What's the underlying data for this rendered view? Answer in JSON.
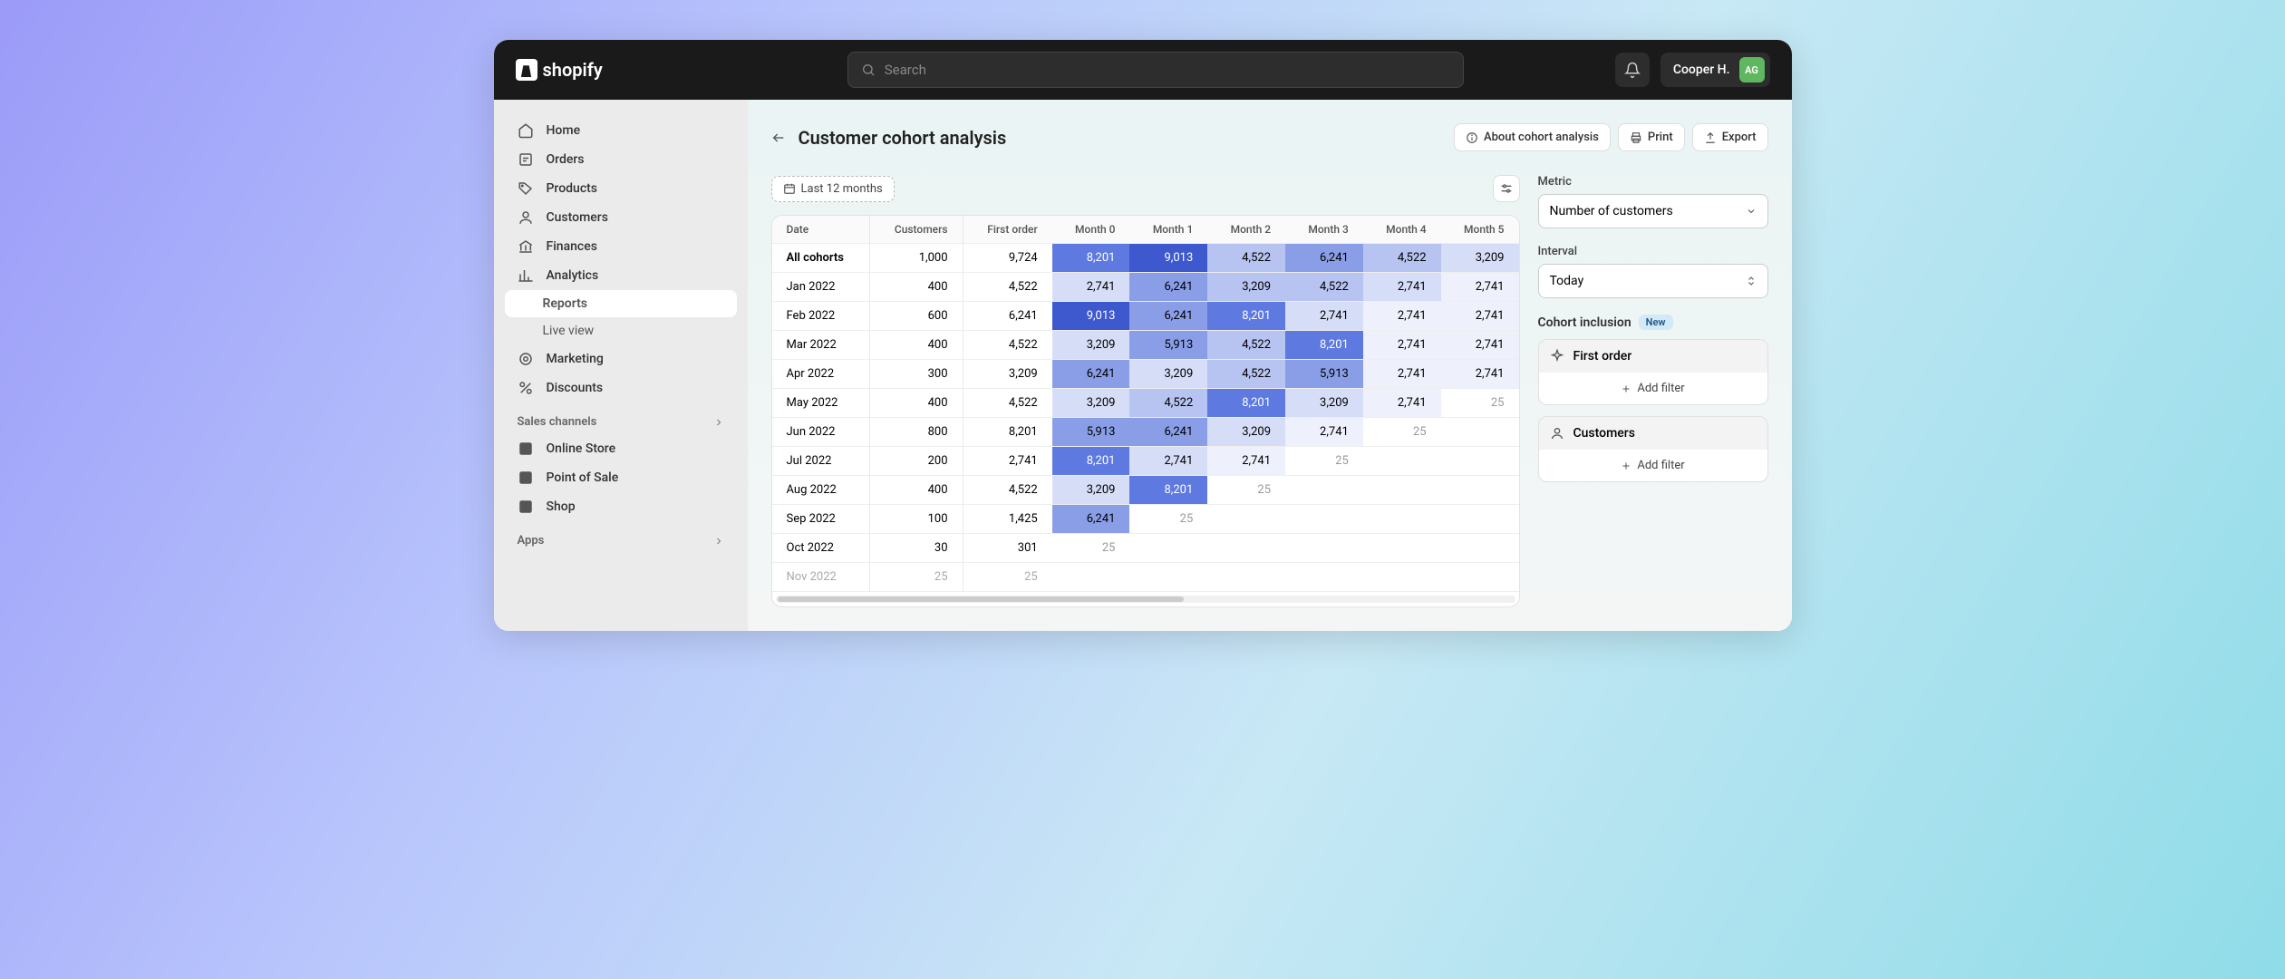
{
  "logo_text": "shopify",
  "search_placeholder": "Search",
  "user_name": "Cooper H.",
  "avatar_initials": "AG",
  "nav": {
    "home": "Home",
    "orders": "Orders",
    "products": "Products",
    "customers": "Customers",
    "finances": "Finances",
    "analytics": "Analytics",
    "reports": "Reports",
    "live_view": "Live view",
    "marketing": "Marketing",
    "discounts": "Discounts",
    "sales_channels": "Sales channels",
    "online_store": "Online Store",
    "pos": "Point of Sale",
    "shop": "Shop",
    "apps": "Apps"
  },
  "page_title": "Customer cohort analysis",
  "actions": {
    "about": "About cohort analysis",
    "print": "Print",
    "export": "Export"
  },
  "date_range": "Last 12 months",
  "right": {
    "metric_label": "Metric",
    "metric_value": "Number of customers",
    "interval_label": "Interval",
    "interval_value": "Today",
    "cohort_inclusion": "Cohort inclusion",
    "new_badge": "New",
    "first_order": "First order",
    "customers": "Customers",
    "add_filter": "Add filter"
  },
  "table": {
    "headers": [
      "Date",
      "Customers",
      "First order",
      "Month 0",
      "Month 1",
      "Month 2",
      "Month 3",
      "Month 4",
      "Month 5"
    ],
    "rows": [
      {
        "label": "All cohorts",
        "customers": "1,000",
        "first": "9,724",
        "m": [
          "8,201",
          "9,013",
          "4,522",
          "6,241",
          "4,522",
          "3,209"
        ],
        "heat": [
          5,
          6,
          3,
          4,
          3,
          2
        ]
      },
      {
        "label": "Jan 2022",
        "customers": "400",
        "first": "4,522",
        "m": [
          "2,741",
          "6,241",
          "3,209",
          "4,522",
          "2,741",
          "2,741"
        ],
        "heat": [
          2,
          4,
          3,
          3,
          2,
          1
        ]
      },
      {
        "label": "Feb 2022",
        "customers": "600",
        "first": "6,241",
        "m": [
          "9,013",
          "6,241",
          "8,201",
          "2,741",
          "2,741",
          "2,741"
        ],
        "heat": [
          6,
          4,
          5,
          2,
          1,
          1
        ]
      },
      {
        "label": "Mar 2022",
        "customers": "400",
        "first": "4,522",
        "m": [
          "3,209",
          "5,913",
          "4,522",
          "8,201",
          "2,741",
          "2,741"
        ],
        "heat": [
          2,
          4,
          3,
          5,
          1,
          1
        ]
      },
      {
        "label": "Apr 2022",
        "customers": "300",
        "first": "3,209",
        "m": [
          "6,241",
          "3,209",
          "4,522",
          "5,913",
          "2,741",
          "2,741"
        ],
        "heat": [
          4,
          2,
          3,
          4,
          1,
          1
        ]
      },
      {
        "label": "May 2022",
        "customers": "400",
        "first": "4,522",
        "m": [
          "3,209",
          "4,522",
          "8,201",
          "3,209",
          "2,741",
          "25"
        ],
        "heat": [
          2,
          3,
          5,
          2,
          1,
          0
        ]
      },
      {
        "label": "Jun 2022",
        "customers": "800",
        "first": "8,201",
        "m": [
          "5,913",
          "6,241",
          "3,209",
          "2,741",
          "25",
          ""
        ],
        "heat": [
          4,
          4,
          2,
          1,
          0,
          0
        ]
      },
      {
        "label": "Jul 2022",
        "customers": "200",
        "first": "2,741",
        "m": [
          "8,201",
          "2,741",
          "2,741",
          "25",
          "",
          ""
        ],
        "heat": [
          5,
          2,
          1,
          0,
          0,
          0
        ]
      },
      {
        "label": "Aug 2022",
        "customers": "400",
        "first": "4,522",
        "m": [
          "3,209",
          "8,201",
          "25",
          "",
          "",
          ""
        ],
        "heat": [
          2,
          5,
          0,
          0,
          0,
          0
        ]
      },
      {
        "label": "Sep 2022",
        "customers": "100",
        "first": "1,425",
        "m": [
          "6,241",
          "25",
          "",
          "",
          "",
          ""
        ],
        "heat": [
          4,
          0,
          0,
          0,
          0,
          0
        ]
      },
      {
        "label": "Oct 2022",
        "customers": "30",
        "first": "301",
        "m": [
          "25",
          "",
          "",
          "",
          "",
          ""
        ],
        "heat": [
          0,
          0,
          0,
          0,
          0,
          0
        ]
      },
      {
        "label": "Nov 2022",
        "customers": "25",
        "first": "25",
        "m": [
          "",
          "",
          "",
          "",
          "",
          ""
        ],
        "heat": [
          0,
          0,
          0,
          0,
          0,
          0
        ],
        "dim": true
      }
    ]
  }
}
